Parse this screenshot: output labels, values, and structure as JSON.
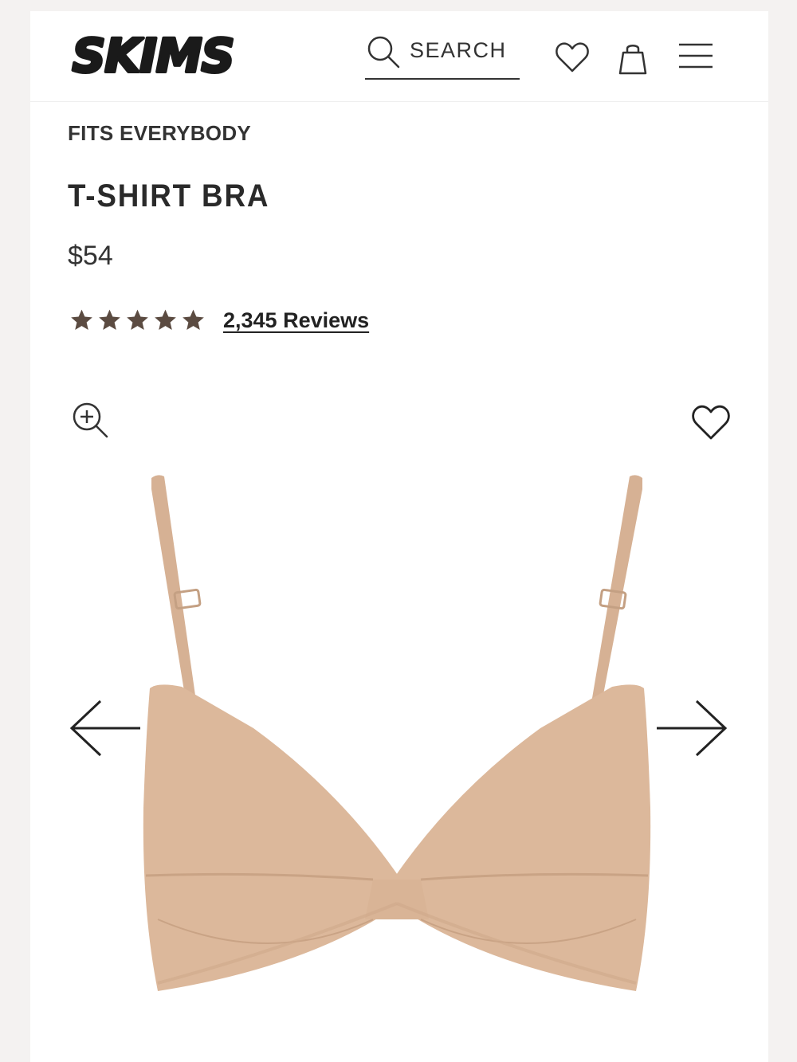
{
  "header": {
    "brand": "SKIMS",
    "search": {
      "label": "SEARCH",
      "icon": "search-icon"
    },
    "icons": [
      "heart-icon",
      "shopping-bag-icon",
      "hamburger-menu-icon"
    ]
  },
  "product": {
    "collection": "FITS EVERYBODY",
    "name": "T-SHIRT BRA",
    "price": "$54",
    "rating": {
      "stars": 5,
      "max_stars": 5,
      "star_color": "#5b4b41"
    },
    "reviews_label": "2,345 Reviews"
  },
  "gallery": {
    "zoom_icon": "zoom-in-icon",
    "favorite_icon": "heart-icon",
    "prev_icon": "arrow-left-icon",
    "next_icon": "arrow-right-icon",
    "product_color": "#dcb89b"
  }
}
